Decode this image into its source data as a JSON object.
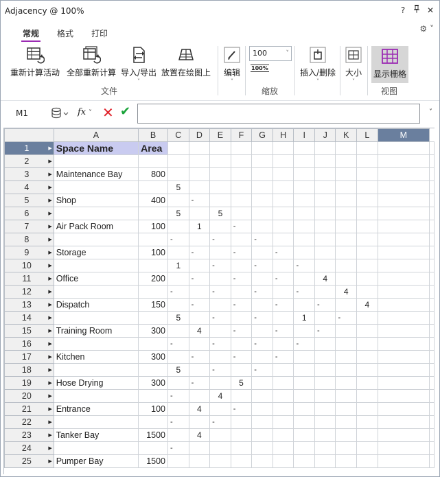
{
  "window": {
    "title": "Adjacency @ 100%",
    "controls": [
      "?",
      "⚑",
      "✕"
    ]
  },
  "tabs": [
    {
      "label": "常规",
      "active": true
    },
    {
      "label": "格式",
      "active": false
    },
    {
      "label": "打印",
      "active": false
    }
  ],
  "ribbon": {
    "recalc_label": "重新计算活动",
    "recalc_all_label": "全部重新计算",
    "import_export_label": "导入/导出",
    "place_label": "放置在绘图上",
    "file_group": "文件",
    "edit_label": "编辑",
    "zoom_value": "100",
    "zoom_100_label": "100%",
    "zoom_group": "缩放",
    "insert_delete_label": "插入/删除",
    "size_label": "大小",
    "show_grid_label": "显示栅格",
    "view_group": "视图"
  },
  "formula_bar": {
    "cell_ref": "M1",
    "fx": "fx",
    "value": ""
  },
  "grid": {
    "columns": [
      "A",
      "B",
      "C",
      "D",
      "E",
      "F",
      "G",
      "H",
      "I",
      "J",
      "K",
      "L",
      "M"
    ],
    "selected_column": "M",
    "rows": [
      {
        "n": "1",
        "a": "Space Name",
        "b": "Area",
        "cells": [
          "",
          "",
          "",
          "",
          "",
          "",
          "",
          "",
          "",
          "",
          ""
        ]
      },
      {
        "n": "2",
        "a": "",
        "b": "",
        "cells": [
          "",
          "",
          "",
          "",
          "",
          "",
          "",
          "",
          "",
          "",
          ""
        ]
      },
      {
        "n": "3",
        "a": "Maintenance Bay",
        "b": "800",
        "cells": [
          "",
          "",
          "",
          "",
          "",
          "",
          "",
          "",
          "",
          "",
          ""
        ]
      },
      {
        "n": "4",
        "a": "",
        "b": "",
        "cells": [
          "5",
          "",
          "",
          "",
          "",
          "",
          "",
          "",
          "",
          "",
          ""
        ]
      },
      {
        "n": "5",
        "a": "Shop",
        "b": "400",
        "cells": [
          "",
          "-",
          "",
          "",
          "",
          "",
          "",
          "",
          "",
          "",
          ""
        ]
      },
      {
        "n": "6",
        "a": "",
        "b": "",
        "cells": [
          "5",
          "",
          "5",
          "",
          "",
          "",
          "",
          "",
          "",
          "",
          ""
        ]
      },
      {
        "n": "7",
        "a": "Air Pack Room",
        "b": "100",
        "cells": [
          "",
          "1",
          "",
          "-",
          "",
          "",
          "",
          "",
          "",
          "",
          ""
        ]
      },
      {
        "n": "8",
        "a": "",
        "b": "",
        "cells": [
          "-",
          "",
          "-",
          "",
          "-",
          "",
          "",
          "",
          "",
          "",
          ""
        ]
      },
      {
        "n": "9",
        "a": "Storage",
        "b": "100",
        "cells": [
          "",
          "-",
          "",
          "-",
          "",
          "-",
          "",
          "",
          "",
          "",
          ""
        ]
      },
      {
        "n": "10",
        "a": "",
        "b": "",
        "cells": [
          "1",
          "",
          "-",
          "",
          "-",
          "",
          "-",
          "",
          "",
          "",
          ""
        ]
      },
      {
        "n": "11",
        "a": "Office",
        "b": "200",
        "cells": [
          "",
          "-",
          "",
          "-",
          "",
          "-",
          "",
          "4",
          "",
          "",
          ""
        ]
      },
      {
        "n": "12",
        "a": "",
        "b": "",
        "cells": [
          "-",
          "",
          "-",
          "",
          "-",
          "",
          "-",
          "",
          "4",
          "",
          ""
        ]
      },
      {
        "n": "13",
        "a": "Dispatch",
        "b": "150",
        "cells": [
          "",
          "-",
          "",
          "-",
          "",
          "-",
          "",
          "-",
          "",
          "4",
          ""
        ]
      },
      {
        "n": "14",
        "a": "",
        "b": "",
        "cells": [
          "5",
          "",
          "-",
          "",
          "-",
          "",
          "1",
          "",
          "-",
          "",
          ""
        ]
      },
      {
        "n": "15",
        "a": "Training Room",
        "b": "300",
        "cells": [
          "",
          "4",
          "",
          "-",
          "",
          "-",
          "",
          "-",
          "",
          "",
          ""
        ]
      },
      {
        "n": "16",
        "a": "",
        "b": "",
        "cells": [
          "-",
          "",
          "-",
          "",
          "-",
          "",
          "-",
          "",
          "",
          "",
          ""
        ]
      },
      {
        "n": "17",
        "a": "Kitchen",
        "b": "300",
        "cells": [
          "",
          "-",
          "",
          "-",
          "",
          "-",
          "",
          "",
          "",
          "",
          ""
        ]
      },
      {
        "n": "18",
        "a": "",
        "b": "",
        "cells": [
          "5",
          "",
          "-",
          "",
          "-",
          "",
          "",
          "",
          "",
          "",
          ""
        ]
      },
      {
        "n": "19",
        "a": "Hose Drying",
        "b": "300",
        "cells": [
          "",
          "-",
          "",
          "5",
          "",
          "",
          "",
          "",
          "",
          "",
          ""
        ]
      },
      {
        "n": "20",
        "a": "",
        "b": "",
        "cells": [
          "-",
          "",
          "4",
          "",
          "",
          "",
          "",
          "",
          "",
          "",
          ""
        ]
      },
      {
        "n": "21",
        "a": "Entrance",
        "b": "100",
        "cells": [
          "",
          "4",
          "",
          "-",
          "",
          "",
          "",
          "",
          "",
          "",
          ""
        ]
      },
      {
        "n": "22",
        "a": "",
        "b": "",
        "cells": [
          "-",
          "",
          "-",
          "",
          "",
          "",
          "",
          "",
          "",
          "",
          ""
        ]
      },
      {
        "n": "23",
        "a": "Tanker Bay",
        "b": "1500",
        "cells": [
          "",
          "4",
          "",
          "",
          "",
          "",
          "",
          "",
          "",
          "",
          ""
        ]
      },
      {
        "n": "24",
        "a": "",
        "b": "",
        "cells": [
          "-",
          "",
          "",
          "",
          "",
          "",
          "",
          "",
          "",
          "",
          ""
        ]
      },
      {
        "n": "25",
        "a": "Pumper Bay",
        "b": "1500",
        "cells": [
          "",
          "",
          "",
          "",
          "",
          "",
          "",
          "",
          "",
          "",
          ""
        ]
      }
    ]
  },
  "colors": {
    "accent": "#9b2bb3",
    "header_fill": "#c9cbf0",
    "selected_header": "#6a7f9e",
    "cancel": "#e0232b",
    "confirm": "#1aa33a"
  }
}
